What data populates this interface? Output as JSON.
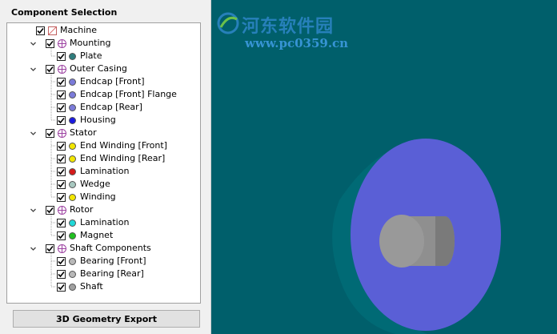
{
  "component_selection": {
    "title": "Component Selection",
    "tree": [
      {
        "label": "Machine",
        "level": 0,
        "kind": "root",
        "checked": true
      },
      {
        "label": "Mounting",
        "level": 1,
        "kind": "group",
        "checked": true,
        "expanded": true
      },
      {
        "label": "Plate",
        "level": 2,
        "kind": "item",
        "checked": true,
        "color": "#2e7d7d"
      },
      {
        "label": "Outer Casing",
        "level": 1,
        "kind": "group",
        "checked": true,
        "expanded": true
      },
      {
        "label": "Endcap [Front]",
        "level": 2,
        "kind": "item",
        "checked": true,
        "color": "#7b7bd9"
      },
      {
        "label": "Endcap [Front] Flange",
        "level": 2,
        "kind": "item",
        "checked": true,
        "color": "#7b7bd9"
      },
      {
        "label": "Endcap [Rear]",
        "level": 2,
        "kind": "item",
        "checked": true,
        "color": "#7b7bd9"
      },
      {
        "label": "Housing",
        "level": 2,
        "kind": "item",
        "checked": true,
        "color": "#1a1ae0"
      },
      {
        "label": "Stator",
        "level": 1,
        "kind": "group",
        "checked": true,
        "expanded": true
      },
      {
        "label": "End Winding [Front]",
        "level": 2,
        "kind": "item",
        "checked": true,
        "color": "#f2e600"
      },
      {
        "label": "End Winding [Rear]",
        "level": 2,
        "kind": "item",
        "checked": true,
        "color": "#f2e600"
      },
      {
        "label": "Lamination",
        "level": 2,
        "kind": "item",
        "checked": true,
        "color": "#d41a1a"
      },
      {
        "label": "Wedge",
        "level": 2,
        "kind": "item",
        "checked": true,
        "color": "#a8c8c0"
      },
      {
        "label": "Winding",
        "level": 2,
        "kind": "item",
        "checked": true,
        "color": "#f2e600"
      },
      {
        "label": "Rotor",
        "level": 1,
        "kind": "group",
        "checked": true,
        "expanded": true
      },
      {
        "label": "Lamination",
        "level": 2,
        "kind": "item",
        "checked": true,
        "color": "#20d8d8"
      },
      {
        "label": "Magnet",
        "level": 2,
        "kind": "item",
        "checked": true,
        "color": "#20c020"
      },
      {
        "label": "Shaft Components",
        "level": 1,
        "kind": "group",
        "checked": true,
        "expanded": true
      },
      {
        "label": "Bearing [Front]",
        "level": 2,
        "kind": "item",
        "checked": true,
        "color": "#b8b8b8"
      },
      {
        "label": "Bearing [Rear]",
        "level": 2,
        "kind": "item",
        "checked": true,
        "color": "#b8b8b8"
      },
      {
        "label": "Shaft",
        "level": 2,
        "kind": "item",
        "checked": true,
        "color": "#a0a0a0"
      }
    ]
  },
  "export_button": {
    "label": "3D Geometry Export"
  },
  "viewport": {
    "background": "#005f6b",
    "endcap_face": "#5a5fd6",
    "endcap_rim": "#006d78",
    "shaft": "#8c8c8c"
  },
  "watermark": {
    "title": "河东软件园",
    "url": "www.pc0359.cn"
  },
  "icons": {
    "check": "check-mark-icon",
    "group": "component-group-icon",
    "machine": "machine-icon",
    "expander": "chevron-down-icon"
  }
}
